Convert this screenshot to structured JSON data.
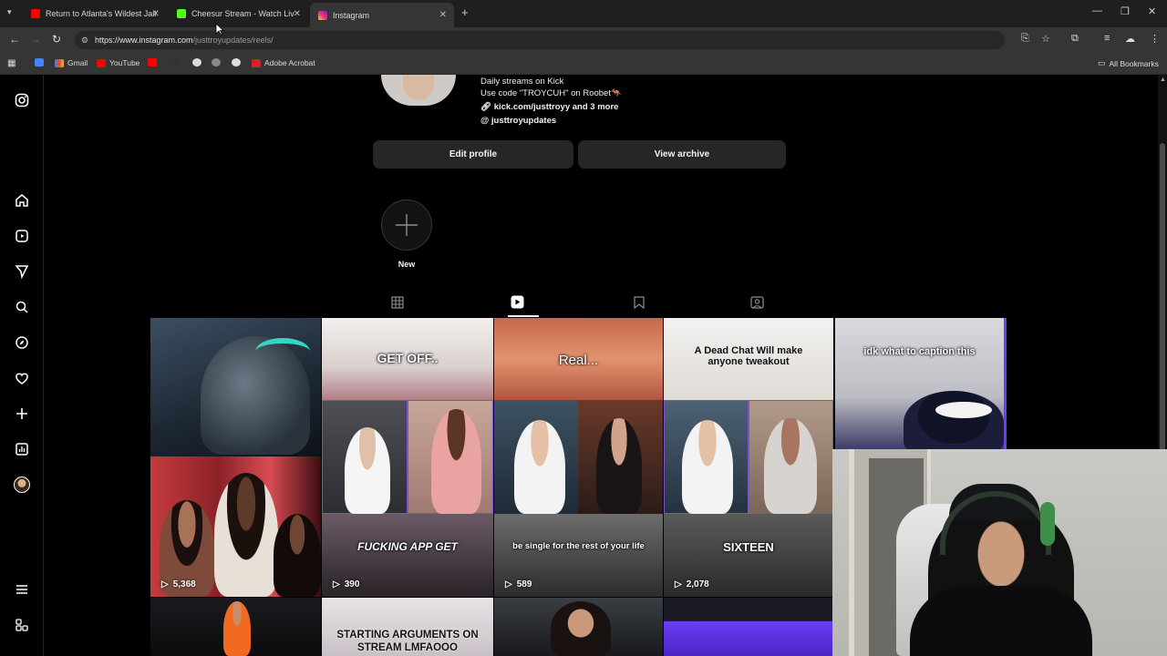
{
  "browser": {
    "tabs": [
      {
        "title": "Return to Atlanta's Wildest Jail",
        "favicon": "youtube-icon",
        "color": "#ff0000"
      },
      {
        "title": "Cheesur Stream - Watch Liv",
        "favicon": "kick-icon",
        "color": "#53fc18"
      },
      {
        "title": "Instagram",
        "favicon": "instagram-icon",
        "color": "#e1306c"
      }
    ],
    "url_host": "https://www.instagram.com",
    "url_path": "/justtroyupdates/reels/",
    "bookmarks": [
      {
        "label": "Gmail",
        "icon": "gmail-icon"
      },
      {
        "label": "YouTube",
        "icon": "youtube-icon"
      },
      {
        "label": "Adobe Acrobat",
        "icon": "acrobat-icon"
      }
    ],
    "all_bookmarks": "All Bookmarks"
  },
  "profile": {
    "bio_lines": [
      "Daily streams on Kick",
      "Use code \"TROYCUH\" on Roobet🦘"
    ],
    "link_text": "kick.com/justtroyy and 3 more",
    "threads_handle": "justtroyupdates",
    "edit_profile": "Edit profile",
    "view_archive": "View archive",
    "highlight_new": "New"
  },
  "reels": [
    {
      "caption": "",
      "views": "5,368"
    },
    {
      "caption": "GET OFF..",
      "views": ""
    },
    {
      "caption": "Real...",
      "views": ""
    },
    {
      "caption": "A Dead Chat Will make anyone tweakout",
      "views": ""
    },
    {
      "caption": "idk what to caption this",
      "views": ""
    },
    {
      "caption": "FUCKING APP GET",
      "views": "390"
    },
    {
      "caption": "be single for the rest of your life",
      "views": "589"
    },
    {
      "caption": "SIXTEEN",
      "views": "2,078"
    },
    {
      "caption": "STARTING ARGUMENTS ON STREAM LMFAOOO",
      "views": ""
    }
  ]
}
